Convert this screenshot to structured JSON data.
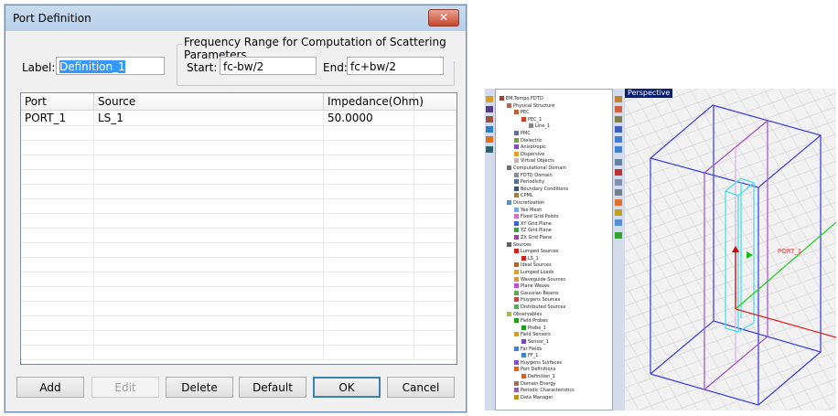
{
  "dialog": {
    "title": "Port Definition",
    "close_icon": "close-icon",
    "label_caption": "Label:",
    "label_value": "Definition_1",
    "freq_group_title": "Frequency Range for Computation of Scattering Parameters",
    "start_caption": "Start:",
    "start_value": "fc-bw/2",
    "end_caption": "End:",
    "end_value": "fc+bw/2",
    "columns": [
      "Port",
      "Source",
      "Impedance(Ohm)"
    ],
    "rows": [
      {
        "port": "PORT_1",
        "source": "LS_1",
        "impedance": "50.0000"
      }
    ],
    "buttons": {
      "add": "Add",
      "edit": "Edit",
      "delete": "Delete",
      "default": "Default",
      "ok": "OK",
      "cancel": "Cancel"
    }
  },
  "app": {
    "viewport_title": "Perspective",
    "port_label": "PORT_1",
    "tree": [
      {
        "label": "EM.Tempo FDTD",
        "level": 0,
        "color": "#a04030"
      },
      {
        "label": "Physical Structure",
        "level": 1,
        "color": "#c06050"
      },
      {
        "label": "PEC",
        "level": 2,
        "color": "#c06030"
      },
      {
        "label": "PEC_1",
        "level": 3,
        "color": "#d04020"
      },
      {
        "label": "Line_1",
        "level": 4,
        "color": "#888888"
      },
      {
        "label": "PMC",
        "level": 2,
        "color": "#6070a0"
      },
      {
        "label": "Dielectric",
        "level": 2,
        "color": "#70a050"
      },
      {
        "label": "Anisotropic",
        "level": 2,
        "color": "#8050c0"
      },
      {
        "label": "Dispersive",
        "level": 2,
        "color": "#e0a030"
      },
      {
        "label": "Virtual Objects",
        "level": 2,
        "color": "#d0b0b0"
      },
      {
        "label": "Computational Domain",
        "level": 1,
        "color": "#707070"
      },
      {
        "label": "FDTD Domain",
        "level": 2,
        "color": "#8090a0"
      },
      {
        "label": "Periodicity",
        "level": 2,
        "color": "#5070a0"
      },
      {
        "label": "Boundary Conditions",
        "level": 2,
        "color": "#405080"
      },
      {
        "label": "CPML",
        "level": 2,
        "color": "#a08040"
      },
      {
        "label": "Discretization",
        "level": 1,
        "color": "#5090d0"
      },
      {
        "label": "Yee Mesh",
        "level": 2,
        "color": "#70b0e0"
      },
      {
        "label": "Fixed Grid Points",
        "level": 2,
        "color": "#d070c0"
      },
      {
        "label": "XY Grid Plane",
        "level": 2,
        "color": "#4060d0"
      },
      {
        "label": "YZ Grid Plane",
        "level": 2,
        "color": "#40a040"
      },
      {
        "label": "ZX Grid Plane",
        "level": 2,
        "color": "#a040a0"
      },
      {
        "label": "Sources",
        "level": 1,
        "color": "#606060"
      },
      {
        "label": "Lumped Sources",
        "level": 2,
        "color": "#d02020"
      },
      {
        "label": "LS_1",
        "level": 3,
        "color": "#d02020"
      },
      {
        "label": "Ideal Sources",
        "level": 2,
        "color": "#c06020"
      },
      {
        "label": "Lumped Loads",
        "level": 2,
        "color": "#e0a020"
      },
      {
        "label": "Waveguide Sources",
        "level": 2,
        "color": "#e09040"
      },
      {
        "label": "Plane Waves",
        "level": 2,
        "color": "#c050d0"
      },
      {
        "label": "Gaussian Beams",
        "level": 2,
        "color": "#70a060"
      },
      {
        "label": "Huygens Sources",
        "level": 2,
        "color": "#d04040"
      },
      {
        "label": "Distributed Sources",
        "level": 2,
        "color": "#50b050"
      },
      {
        "label": "Observables",
        "level": 1,
        "color": "#a0c040"
      },
      {
        "label": "Field Probes",
        "level": 2,
        "color": "#20a020"
      },
      {
        "label": "Probe_1",
        "level": 3,
        "color": "#20a020"
      },
      {
        "label": "Field Sensors",
        "level": 2,
        "color": "#d0a020"
      },
      {
        "label": "Sensor_1",
        "level": 3,
        "color": "#8040c0"
      },
      {
        "label": "Far Fields",
        "level": 2,
        "color": "#4080d0"
      },
      {
        "label": "FF_1",
        "level": 3,
        "color": "#4080d0"
      },
      {
        "label": "Huygens Surfaces",
        "level": 2,
        "color": "#8050d0"
      },
      {
        "label": "Port Definitions",
        "level": 2,
        "color": "#e06020"
      },
      {
        "label": "Definition_1",
        "level": 3,
        "color": "#e06020"
      },
      {
        "label": "Domain Energy",
        "level": 2,
        "color": "#a07050"
      },
      {
        "label": "Periodic Characteristics",
        "level": 2,
        "color": "#9060b0"
      },
      {
        "label": "Data Manager",
        "level": 2,
        "color": "#c09020"
      }
    ]
  }
}
